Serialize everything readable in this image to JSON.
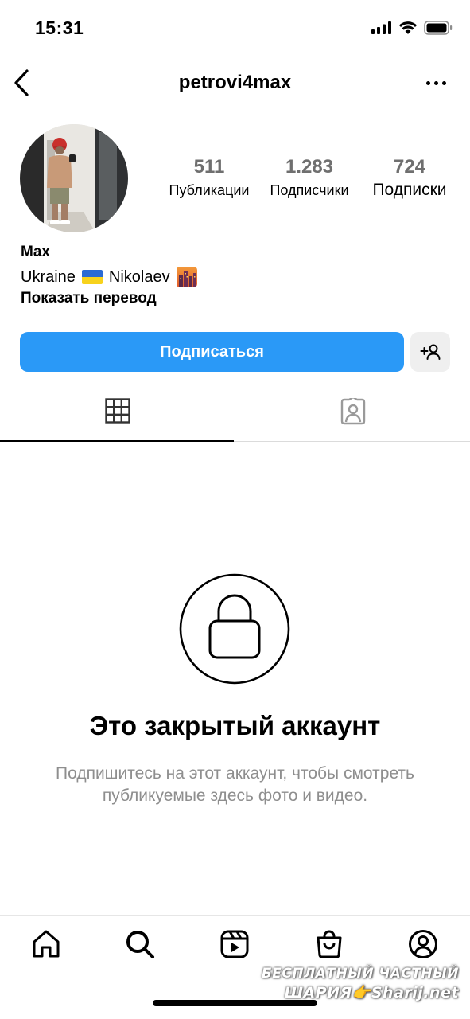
{
  "status_bar": {
    "time": "15:31"
  },
  "header": {
    "username": "petrovi4max"
  },
  "stats": [
    {
      "count": "511",
      "label": "Публикации"
    },
    {
      "count": "1.283",
      "label": "Подписчики"
    },
    {
      "count": "724",
      "label": "Подписки"
    }
  ],
  "bio": {
    "name": "Max",
    "country": "Ukraine",
    "city": "Nikolaev",
    "translate": "Показать перевод"
  },
  "actions": {
    "follow": "Подписаться"
  },
  "private": {
    "title": "Это закрытый аккаунт",
    "subtitle": "Подпишитесь на этот аккаунт, чтобы смотреть публикуемые здесь фото и видео."
  },
  "watermark": {
    "line1": "БЕСПЛАТНЫЙ ЧАСТНЫЙ",
    "line2": "ШАРИЯ👉Sharij.net"
  },
  "colors": {
    "accent": "#2a99f7",
    "muted": "#8e8e8e"
  }
}
